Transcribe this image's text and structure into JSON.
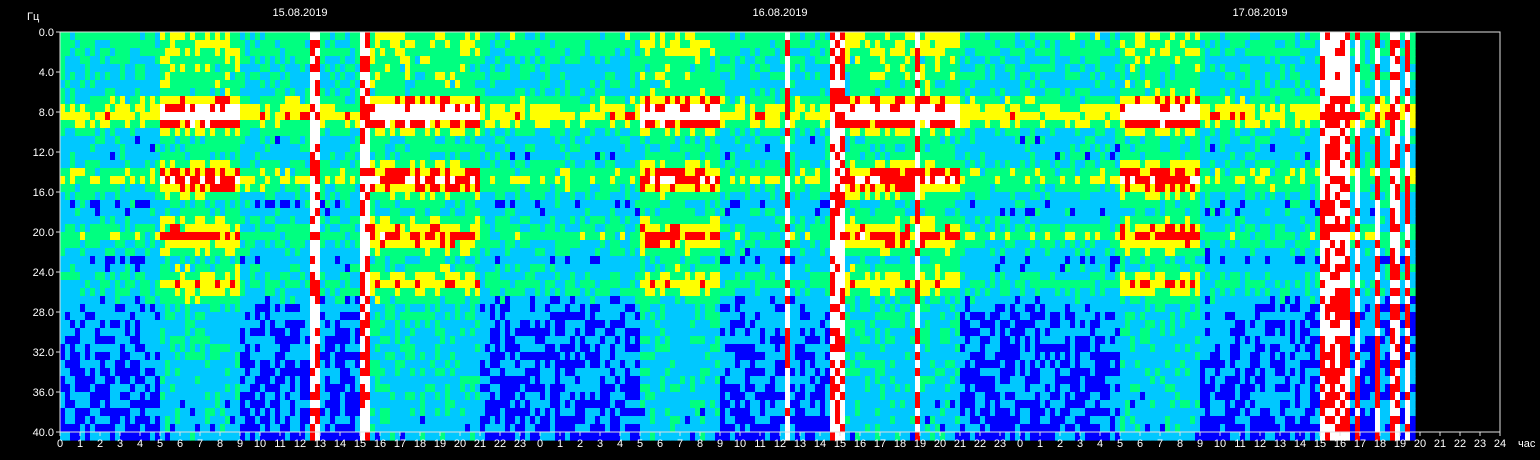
{
  "chart_data": {
    "type": "heatmap",
    "title": "",
    "ylabel": "Гц",
    "xlabel": "час",
    "ylim": [
      0,
      40
    ],
    "y_ticks": [
      "0.0",
      "4.0",
      "8.0",
      "12.0",
      "16.0",
      "20.0",
      "24.0",
      "28.0",
      "32.0",
      "36.0",
      "40.0"
    ],
    "x_ticks": [
      "0",
      "1",
      "2",
      "3",
      "4",
      "5",
      "6",
      "7",
      "8",
      "9",
      "10",
      "11",
      "12",
      "13",
      "14",
      "15",
      "16",
      "17",
      "18",
      "19",
      "20",
      "21",
      "22",
      "23",
      "0",
      "1",
      "2",
      "3",
      "4",
      "5",
      "6",
      "7",
      "8",
      "9",
      "10",
      "11",
      "12",
      "13",
      "14",
      "15",
      "16",
      "17",
      "18",
      "19",
      "20",
      "21",
      "22",
      "23",
      "0",
      "1",
      "2",
      "3",
      "4",
      "5",
      "6",
      "7",
      "8",
      "9",
      "10",
      "11",
      "12",
      "13",
      "14",
      "15",
      "16",
      "17",
      "18",
      "19",
      "20",
      "21",
      "22",
      "23",
      "24"
    ],
    "dates": [
      {
        "label": "15.08.2019",
        "hour": 12
      },
      {
        "label": "16.08.2019",
        "hour": 36
      },
      {
        "label": "17.08.2019",
        "hour": 60
      }
    ],
    "x_range_hours": [
      0,
      72
    ],
    "data_end_hour": 67.6,
    "colormap": [
      "#000080",
      "#0000ff",
      "#00c8ff",
      "#00ff80",
      "#ffff00",
      "#ff0000",
      "#ffffff"
    ],
    "bands": [
      {
        "freq_hz": 7.8,
        "intensity": 0.75
      },
      {
        "freq_hz": 14.3,
        "intensity": 0.55
      },
      {
        "freq_hz": 20.0,
        "intensity": 0.45
      },
      {
        "freq_hz": 24.8,
        "intensity": 0.35
      }
    ],
    "active_periods_hours": [
      [
        5,
        9
      ],
      [
        15,
        21
      ],
      [
        29,
        33
      ],
      [
        39,
        45
      ],
      [
        53,
        57
      ]
    ],
    "saturated_intervals_hours": [
      [
        12.5,
        12.8
      ],
      [
        15.0,
        15.4
      ],
      [
        36.2,
        36.5
      ],
      [
        38.5,
        39.2
      ],
      [
        42.6,
        42.8
      ],
      [
        63.0,
        64.4
      ],
      [
        64.6,
        65.0
      ],
      [
        65.7,
        66.0
      ],
      [
        66.4,
        66.8
      ],
      [
        67.1,
        67.5
      ]
    ]
  }
}
